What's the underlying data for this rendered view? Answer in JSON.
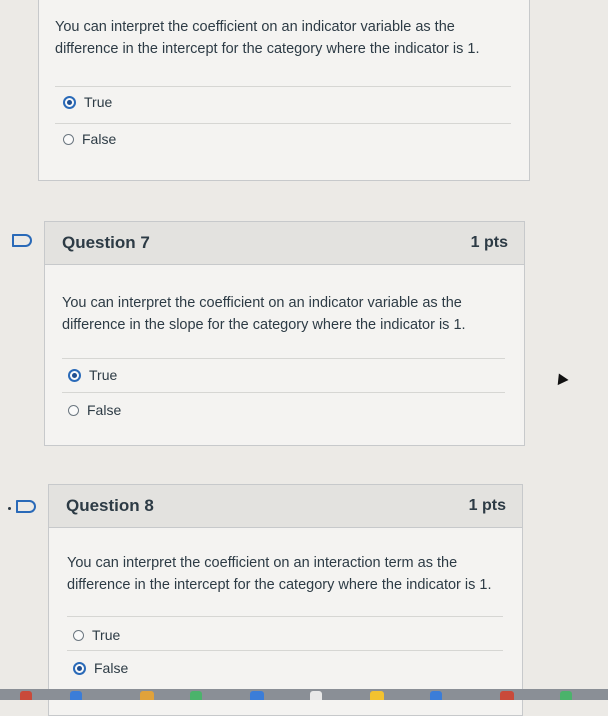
{
  "previous_question": {
    "text": "You can interpret the coefficient on an indicator variable as the difference in the intercept for the category where the indicator is 1.",
    "answers": [
      {
        "label": "True",
        "selected": true
      },
      {
        "label": "False",
        "selected": false
      }
    ]
  },
  "question7": {
    "title": "Question 7",
    "points": "1 pts",
    "text": "You can interpret the coefficient on an indicator variable as the difference in the slope for the category where the indicator is 1.",
    "answers": [
      {
        "label": "True",
        "selected": true
      },
      {
        "label": "False",
        "selected": false
      }
    ]
  },
  "question8": {
    "title": "Question 8",
    "points": "1 pts",
    "text": "You can interpret the coefficient on an interaction term as the difference in the intercept for the category where the indicator is 1.",
    "answers": [
      {
        "label": "True",
        "selected": false
      },
      {
        "label": "False",
        "selected": true
      }
    ]
  },
  "icons": {
    "flag": "bookmark-flag-icon",
    "cursor": "mouse-pointer-icon"
  },
  "colors": {
    "accent": "#2a6ab8",
    "card_bg": "#f4f3f1",
    "header_bg": "#e3e2df"
  }
}
